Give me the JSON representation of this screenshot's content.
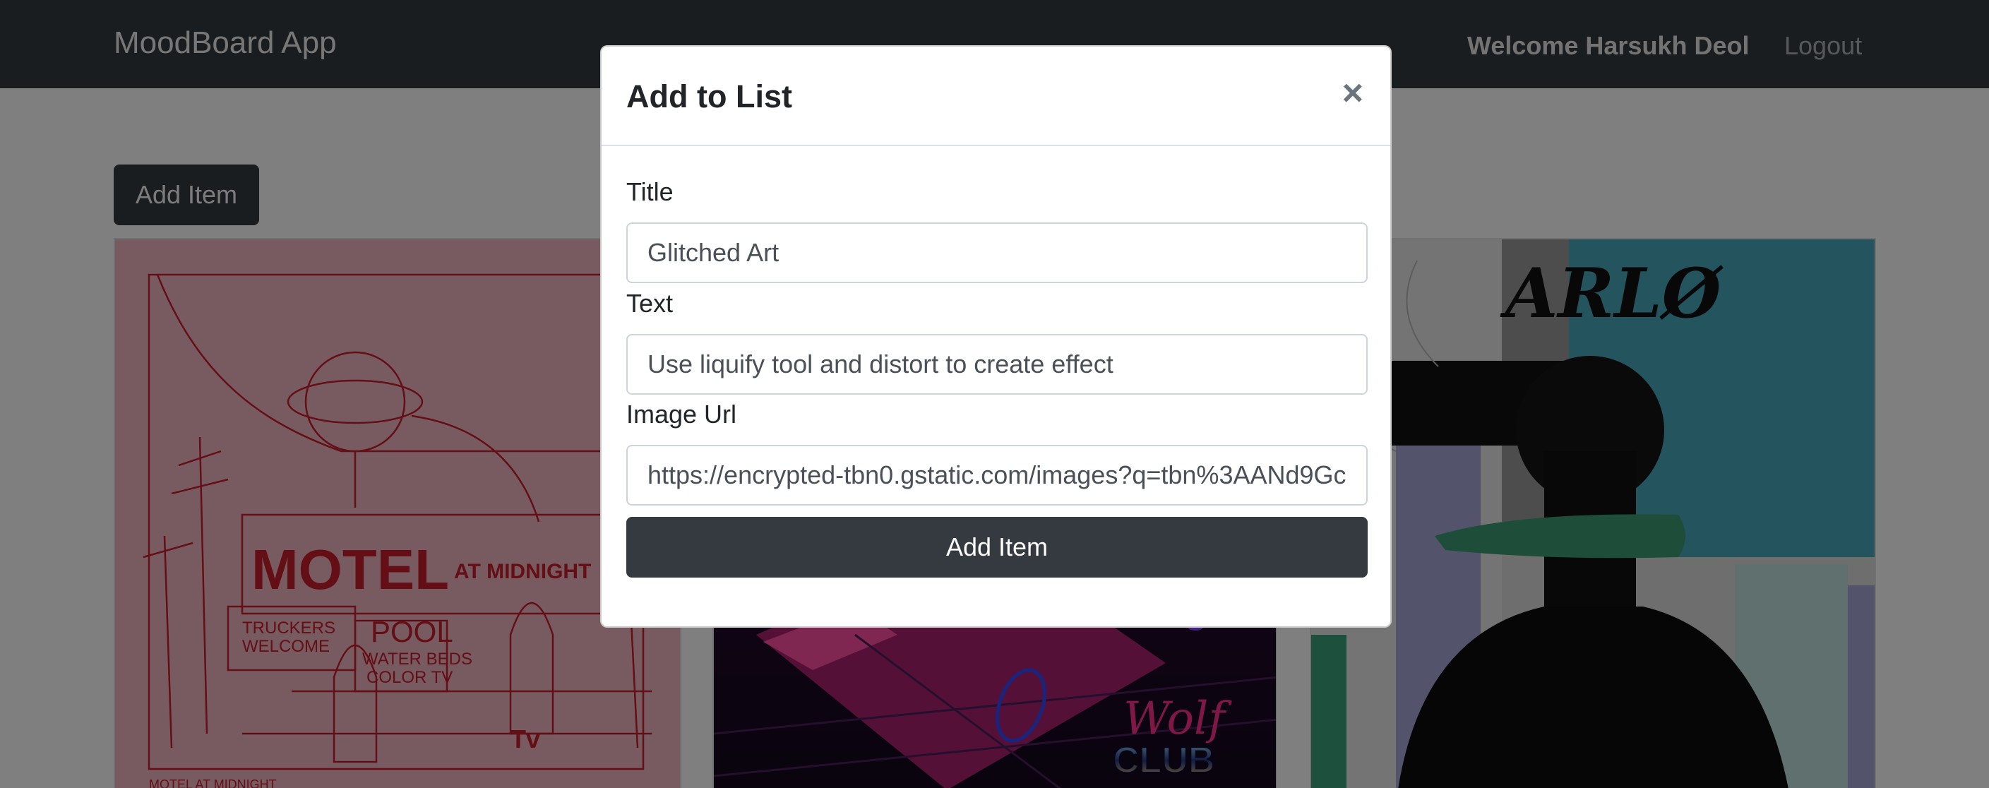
{
  "navbar": {
    "brand": "MoodBoard App",
    "welcome": "Welcome Harsukh Deol",
    "logout": "Logout"
  },
  "page": {
    "add_item_button": "Add Item"
  },
  "cards": [
    {
      "image_name": "motel-at-midnight-poster",
      "texts": {
        "motel": "MOTEL",
        "at_midnight": "AT MIDNIGHT",
        "truckers": "TRUCKERS",
        "welcome": "WELCOME",
        "pool": "POOL",
        "water_beds": "WATER BEDS",
        "color_tv": "COLOR TV",
        "tv": "Tv",
        "caption": "MOTEL AT MIDNIGHT"
      }
    },
    {
      "image_name": "wolf-club-synthwave-car",
      "texts": {
        "wolf": "Wolf",
        "club": "CLUB"
      }
    },
    {
      "image_name": "arlo-collage-portrait",
      "texts": {
        "arlo": "ARLØ"
      }
    }
  ],
  "modal": {
    "title": "Add to List",
    "close": "×",
    "title_label": "Title",
    "title_value": "Glitched Art",
    "text_label": "Text",
    "text_value": "Use liquify tool and distort to create effect",
    "image_label": "Image Url",
    "image_value": "https://encrypted-tbn0.gstatic.com/images?q=tbn%3AANd9Gc",
    "submit": "Add Item"
  },
  "colors": {
    "navbar": "#343a40",
    "backdrop": "rgba(0,0,0,0.5)",
    "button": "#343a40"
  }
}
